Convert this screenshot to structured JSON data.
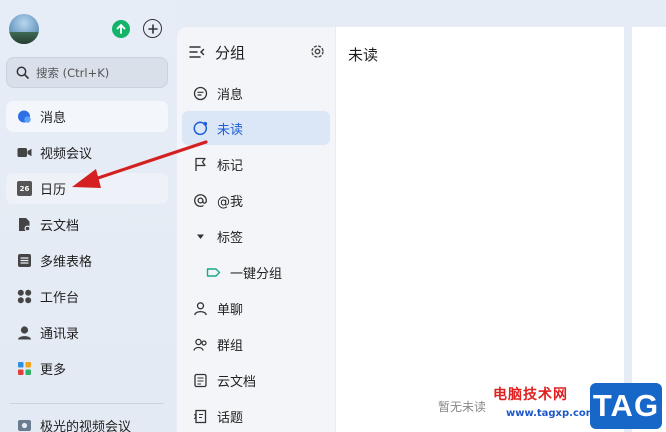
{
  "colors": {
    "accent": "#1d5fd8",
    "active_group_bg": "#dbe6f7",
    "upload_green": "#14b36a",
    "arrow_red": "#d42020",
    "watermark_blue": "#1767c8"
  },
  "nav": {
    "search_placeholder": "搜索 (Ctrl+K)",
    "items": [
      {
        "label": "消息",
        "icon": "chat-bubble-icon"
      },
      {
        "label": "视频会议",
        "icon": "video-camera-icon"
      },
      {
        "label": "日历",
        "icon": "calendar-icon",
        "badge": "26"
      },
      {
        "label": "云文档",
        "icon": "cloud-doc-icon"
      },
      {
        "label": "多维表格",
        "icon": "table-icon"
      },
      {
        "label": "工作台",
        "icon": "workspace-grid-icon"
      },
      {
        "label": "通讯录",
        "icon": "contacts-icon"
      },
      {
        "label": "更多",
        "icon": "more-apps-icon"
      },
      {
        "label": "极光的视频会议",
        "icon": "meeting-icon"
      }
    ]
  },
  "groups": {
    "title": "分组",
    "items": [
      {
        "label": "消息",
        "icon": "message-icon"
      },
      {
        "label": "未读",
        "icon": "unread-icon"
      },
      {
        "label": "标记",
        "icon": "flag-icon"
      },
      {
        "label": "@我",
        "icon": "at-icon"
      },
      {
        "label": "标签",
        "icon": "caret-down-icon"
      },
      {
        "label": "一键分组",
        "icon": "tag-icon"
      },
      {
        "label": "单聊",
        "icon": "person-icon"
      },
      {
        "label": "群组",
        "icon": "group-icon"
      },
      {
        "label": "云文档",
        "icon": "doc-icon"
      },
      {
        "label": "话题",
        "icon": "topic-icon"
      }
    ]
  },
  "main": {
    "title": "未读",
    "empty_text": "暂无未读"
  },
  "watermark": {
    "site_name": "电脑技术网",
    "url": "www.tagxp.com",
    "tag": "TAG"
  }
}
